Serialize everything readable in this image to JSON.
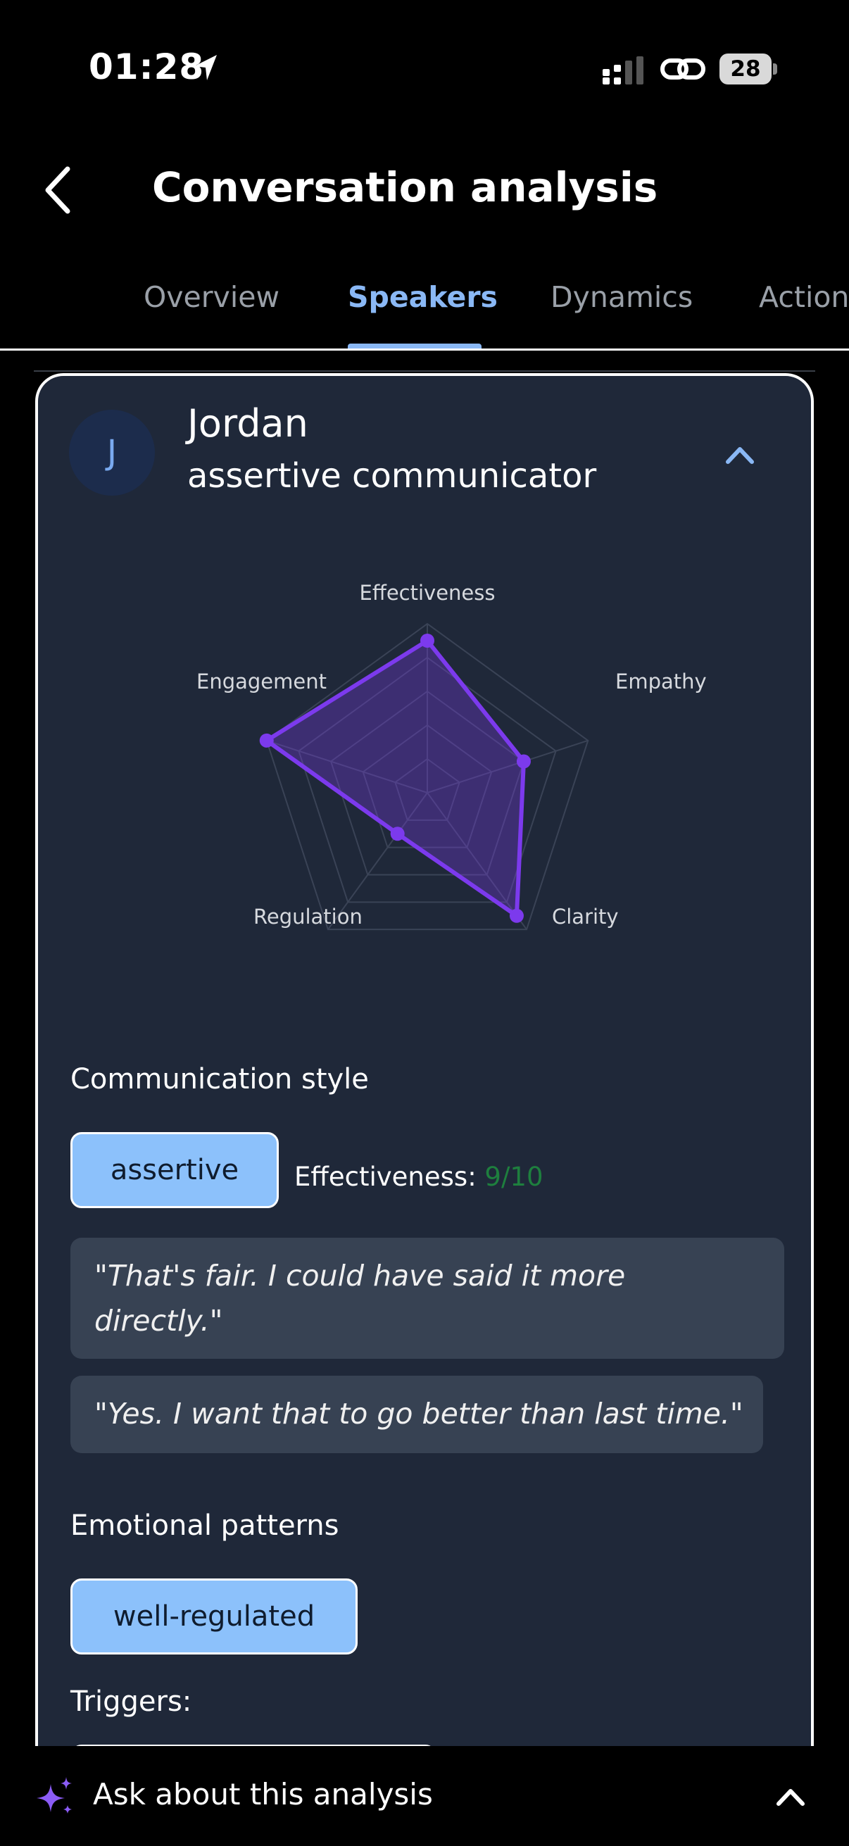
{
  "status_bar": {
    "time": "01:28",
    "battery": "28"
  },
  "header": {
    "title": "Conversation analysis"
  },
  "tabs": [
    {
      "label": "Overview",
      "active": false
    },
    {
      "label": "Speakers",
      "active": true
    },
    {
      "label": "Dynamics",
      "active": false
    },
    {
      "label": "Actions",
      "active": false
    }
  ],
  "speaker": {
    "avatar_letter": "J",
    "name": "Jordan",
    "style": "assertive communicator"
  },
  "chart_data": {
    "type": "radar",
    "axes": [
      "Effectiveness",
      "Empathy",
      "Clarity",
      "Regulation",
      "Engagement"
    ],
    "values": [
      9,
      6,
      9,
      3,
      10
    ],
    "range": [
      0,
      10
    ],
    "grid_levels": 5,
    "color": "#7c3aed"
  },
  "communication": {
    "heading": "Communication style",
    "style_chip": "assertive",
    "effectiveness_label": "Effectiveness: ",
    "effectiveness_value": "9/10",
    "quotes": [
      "\"That's fair. I could have said it more directly.\"",
      "\"Yes. I want that to go better than last time.\""
    ]
  },
  "emotional": {
    "heading": "Emotional patterns",
    "chip": "well-regulated",
    "triggers_label": "Triggers:"
  },
  "bottom_bar": {
    "label": "Ask about this analysis"
  },
  "colors": {
    "accent": "#8ab8f5",
    "card_bg": "#1f2839",
    "chip_bg": "#8cc1fb",
    "effectiveness_green": "#1e7f3e",
    "sparkle": "#8b5cf6"
  }
}
